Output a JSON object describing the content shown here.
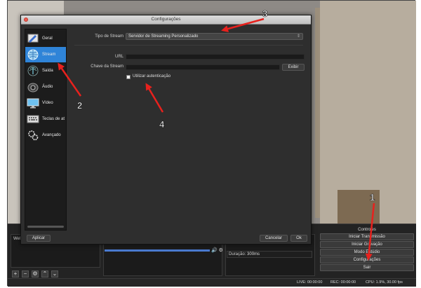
{
  "dialog": {
    "title": "Configurações",
    "sidebar": [
      {
        "label": "Geral",
        "icon": "general-settings-icon"
      },
      {
        "label": "Stream",
        "icon": "stream-globe-icon",
        "active": true
      },
      {
        "label": "Saída",
        "icon": "output-icon"
      },
      {
        "label": "Áudio",
        "icon": "speaker-icon"
      },
      {
        "label": "Vídeo",
        "icon": "monitor-icon"
      },
      {
        "label": "Teclas de at",
        "icon": "keyboard-icon"
      },
      {
        "label": "Avançado",
        "icon": "gears-icon"
      }
    ],
    "stream_type_label": "Tipo de Stream",
    "stream_type_value": "Servidor de Streaming Personalizado",
    "url_label": "URL",
    "url_value": "",
    "stream_key_label": "Chave da Stream",
    "stream_key_value": "",
    "show_button": "Exibir",
    "auth_checkbox_label": "Utilizar autenticação",
    "auth_checked": false,
    "apply_button": "Aplicar",
    "cancel_button": "Cancelar",
    "ok_button": "Ok"
  },
  "main": {
    "scenes_text": "Wel",
    "duration_label": "Duração",
    "duration_value": "300ms",
    "controls_title": "Controles",
    "controls": [
      "Iniciar Transmissão",
      "Iniciar Gravação",
      "Modo Estúdio",
      "Configurações",
      "Sair"
    ],
    "status": {
      "live": "LIVE: 00:00:00",
      "rec": "REC: 00:00:00",
      "cpu": "CPU: 1.9%, 30.00 fps"
    }
  },
  "annotations": [
    "1",
    "2",
    "3",
    "4"
  ],
  "colors": {
    "accent": "#2f84d8",
    "arrow": "#e8211d"
  }
}
